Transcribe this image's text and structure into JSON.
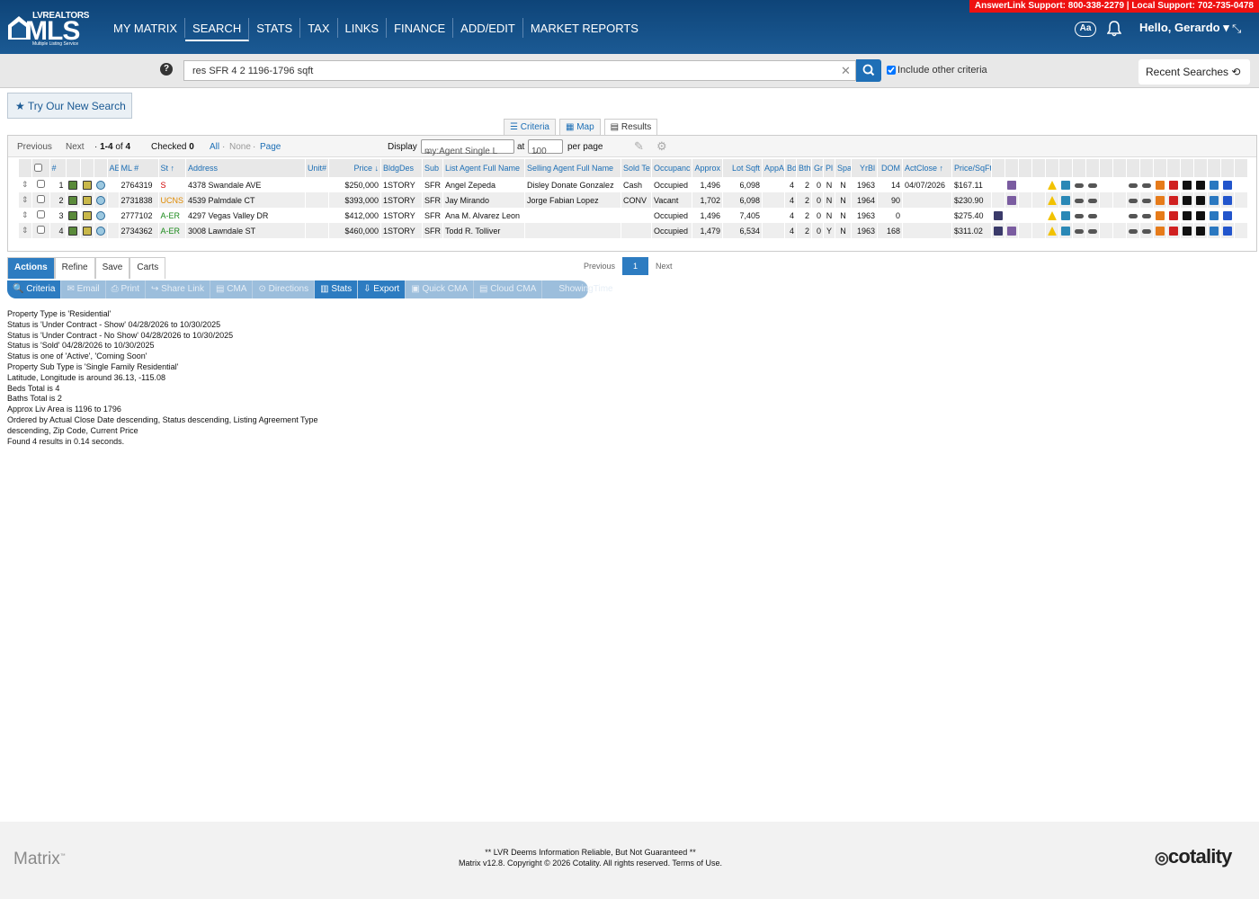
{
  "support": {
    "text": "AnswerLink Support: 800-338-2279 | Local Support: 702-735-0478"
  },
  "logo": {
    "top": "LVREALTORS",
    "big": "MLS",
    "sub": "Multiple Listing Service"
  },
  "nav": [
    "MY MATRIX",
    "SEARCH",
    "STATS",
    "TAX",
    "LINKS",
    "FINANCE",
    "ADD/EDIT",
    "MARKET REPORTS"
  ],
  "header": {
    "font_btn": "Aa",
    "hello": "Hello, Gerardo"
  },
  "search": {
    "help": "?",
    "query": "res SFR 4 2 1196-1796 sqft",
    "include_label": "Include other criteria",
    "recent": "Recent Searches"
  },
  "try_new": "Try Our New Search",
  "view_tabs": [
    "Criteria",
    "Map",
    "Results"
  ],
  "pager": {
    "previous": "Previous",
    "next": "Next",
    "range": "1-4",
    "of": "of",
    "total": "4",
    "checked": "Checked",
    "checked_count": "0",
    "all": "All",
    "none": "None",
    "page": "Page",
    "display": "Display",
    "display_value": "my:Agent Single L",
    "at": "at",
    "per_page_value": "100",
    "per_page": "per page"
  },
  "columns": [
    "#",
    "",
    "",
    "",
    "AE",
    "ML #",
    "St",
    "Address",
    "Unit#",
    "Price",
    "BldgDes",
    "Sub",
    "List Agent Full Name",
    "Selling Agent Full Name",
    "Sold Te",
    "Occupanc",
    "Approx",
    "Lot Sqft",
    "AppA",
    "Bd",
    "Bth",
    "Gr",
    "Pl",
    "Spa",
    "YrBl",
    "DOM",
    "ActClose",
    "Price/SqFt"
  ],
  "rows": [
    {
      "n": "1",
      "ml": "2764319",
      "st": "S",
      "st_color": "#d00000",
      "addr": "4378 Swandale AVE",
      "unit": "",
      "price": "$250,000",
      "bldg": "1STORY",
      "sub": "SFR",
      "list_agent": "Angel Zepeda",
      "sell_agent": "Disley Donate Gonzalez",
      "sold_terms": "Cash",
      "occ": "Occupied",
      "approx": "1,496",
      "lot": "6,098",
      "appa": "",
      "bd": "4",
      "bth": "2",
      "gr": "0",
      "pl": "N",
      "spa": "N",
      "yr": "1963",
      "dom": "14",
      "close": "04/07/2026",
      "ppsf": "$167.11"
    },
    {
      "n": "2",
      "ml": "2731838",
      "st": "UCNS",
      "st_color": "#e08a00",
      "addr": "4539 Palmdale CT",
      "unit": "",
      "price": "$393,000",
      "bldg": "1STORY",
      "sub": "SFR",
      "list_agent": "Jay Mirando",
      "sell_agent": "Jorge Fabian Lopez",
      "sold_terms": "CONV",
      "occ": "Vacant",
      "approx": "1,702",
      "lot": "6,098",
      "appa": "",
      "bd": "4",
      "bth": "2",
      "gr": "0",
      "pl": "N",
      "spa": "N",
      "yr": "1964",
      "dom": "90",
      "close": "",
      "ppsf": "$230.90"
    },
    {
      "n": "3",
      "ml": "2777102",
      "st": "A-ER",
      "st_color": "#1a8a1a",
      "addr": "4297 Vegas Valley DR",
      "unit": "",
      "price": "$412,000",
      "bldg": "1STORY",
      "sub": "SFR",
      "list_agent": "Ana M. Alvarez Leon",
      "sell_agent": "",
      "sold_terms": "",
      "occ": "Occupied",
      "approx": "1,496",
      "lot": "7,405",
      "appa": "",
      "bd": "4",
      "bth": "2",
      "gr": "0",
      "pl": "N",
      "spa": "N",
      "yr": "1963",
      "dom": "0",
      "close": "",
      "ppsf": "$275.40"
    },
    {
      "n": "4",
      "ml": "2734362",
      "st": "A-ER",
      "st_color": "#1a8a1a",
      "addr": "3008 Lawndale ST",
      "unit": "",
      "price": "$460,000",
      "bldg": "1STORY",
      "sub": "SFR",
      "list_agent": "Todd R. Tolliver",
      "sell_agent": "",
      "sold_terms": "",
      "occ": "Occupied",
      "approx": "1,479",
      "lot": "6,534",
      "appa": "",
      "bd": "4",
      "bth": "2",
      "gr": "0",
      "pl": "Y",
      "spa": "N",
      "yr": "1963",
      "dom": "168",
      "close": "",
      "ppsf": "$311.02"
    }
  ],
  "action_tabs": [
    "Actions",
    "Refine",
    "Save",
    "Carts"
  ],
  "action_buttons": [
    "Criteria",
    "Email",
    "Print",
    "Share Link",
    "CMA",
    "Directions",
    "Stats",
    "Export",
    "Quick CMA",
    "Cloud CMA",
    "ShowingTime"
  ],
  "pager2": {
    "previous": "Previous",
    "current": "1",
    "next": "Next"
  },
  "criteria_lines": [
    "Property Type is 'Residential'",
    "Status is 'Under Contract - Show' 04/28/2026 to 10/30/2025",
    "Status is 'Under Contract - No Show' 04/28/2026 to 10/30/2025",
    "Status is 'Sold' 04/28/2026 to 10/30/2025",
    "Status is one of 'Active', 'Coming Soon'",
    "Property Sub Type is 'Single Family Residential'",
    "Latitude, Longitude is around 36.13, -115.08",
    "Beds Total is 4",
    "Baths Total is 2",
    "Approx Liv Area is 1196 to 1796",
    "Ordered by Actual Close Date descending, Status descending, Listing Agreement Type",
    "descending, Zip Code, Current Price",
    "Found 4 results in 0.14 seconds."
  ],
  "footer": {
    "matrix": "Matrix",
    "line1": "** LVR Deems Information Reliable, But Not Guaranteed **",
    "line2": "Matrix v12.8. Copyright © 2026 Cotality. All rights reserved. Terms of Use.",
    "brand": "cotality"
  }
}
